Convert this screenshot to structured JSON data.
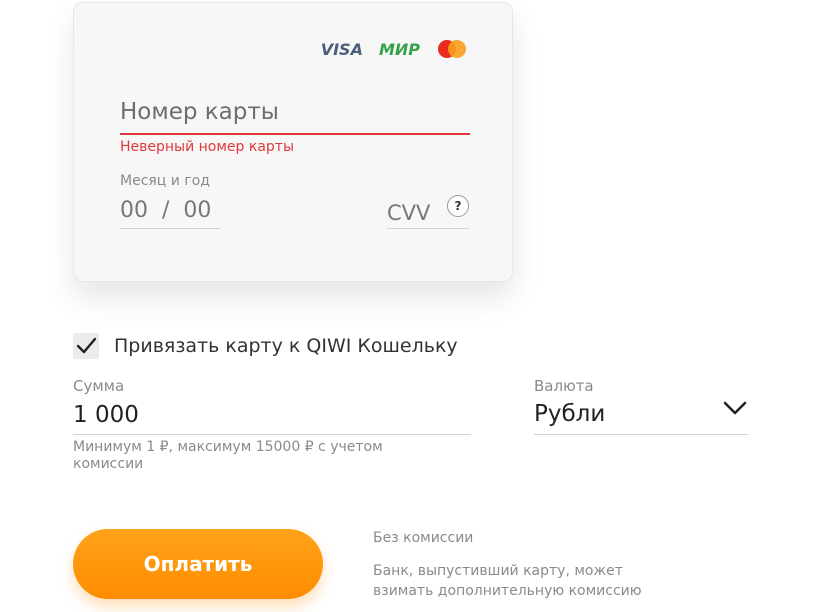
{
  "card_form": {
    "brands": [
      "VISA",
      "МИР",
      "mastercard"
    ],
    "card_number": {
      "placeholder": "Номер карты",
      "error": "Неверный номер карты",
      "border_color": "#e0383b"
    },
    "expiry": {
      "label": "Месяц и год",
      "placeholder": "00  /  00"
    },
    "cvv": {
      "placeholder": "CVV",
      "help_icon": "?"
    }
  },
  "bind_card": {
    "checked": true,
    "label": "Привязать карту к QIWI Кошельку"
  },
  "amount": {
    "label": "Сумма",
    "value": "1 000",
    "hint": "Минимум 1 ₽, максимум 15000 ₽ с учетом комиссии"
  },
  "currency": {
    "label": "Валюта",
    "selected": "Рубли"
  },
  "pay_button": {
    "label": "Оплатить",
    "color": "#ff9600"
  },
  "fee_info": {
    "title": "Без комиссии",
    "note": "Банк, выпустивший карту, может взимать дополнительную комиссию"
  },
  "icons": [
    "visa-logo",
    "mir-logo",
    "mastercard-logo",
    "question-icon",
    "checkmark-icon",
    "chevron-down-icon"
  ]
}
